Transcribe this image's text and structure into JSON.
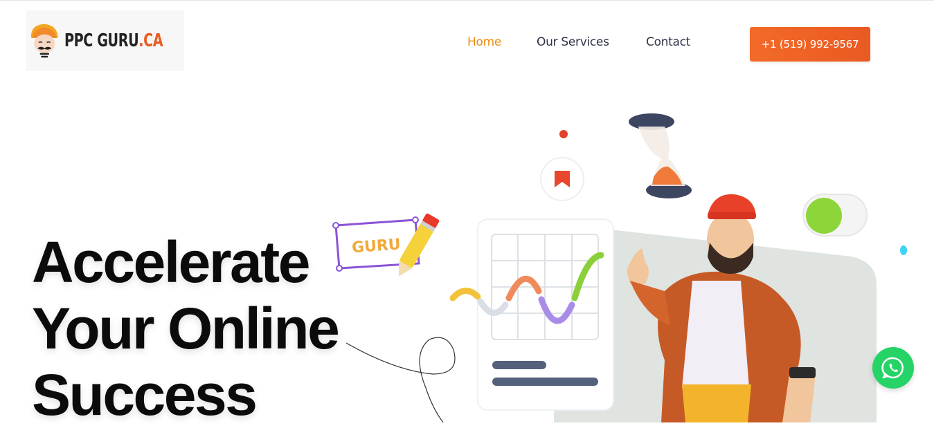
{
  "brand": {
    "name_part1": "PPC GURU",
    "name_part2": ".CA",
    "accent_color": "#e95c1f"
  },
  "nav": {
    "items": [
      {
        "label": "Home",
        "active": true
      },
      {
        "label": "Our Services",
        "active": false
      },
      {
        "label": "Contact",
        "active": false
      }
    ],
    "active_color": "#eb8b12"
  },
  "cta": {
    "phone_label": "+1 (519) 992-9567",
    "color": "#f26a28"
  },
  "hero": {
    "title_lines": [
      "Accelerate",
      "Your Online",
      "Success"
    ]
  },
  "illustration": {
    "sign_text": "GURU",
    "icons": [
      "bookmark-icon",
      "hourglass-icon",
      "toggle-switch-icon",
      "pencil-icon",
      "line-chart-icon"
    ]
  },
  "floating": {
    "whatsapp_icon": "whatsapp-icon",
    "whatsapp_color": "#25d366"
  }
}
